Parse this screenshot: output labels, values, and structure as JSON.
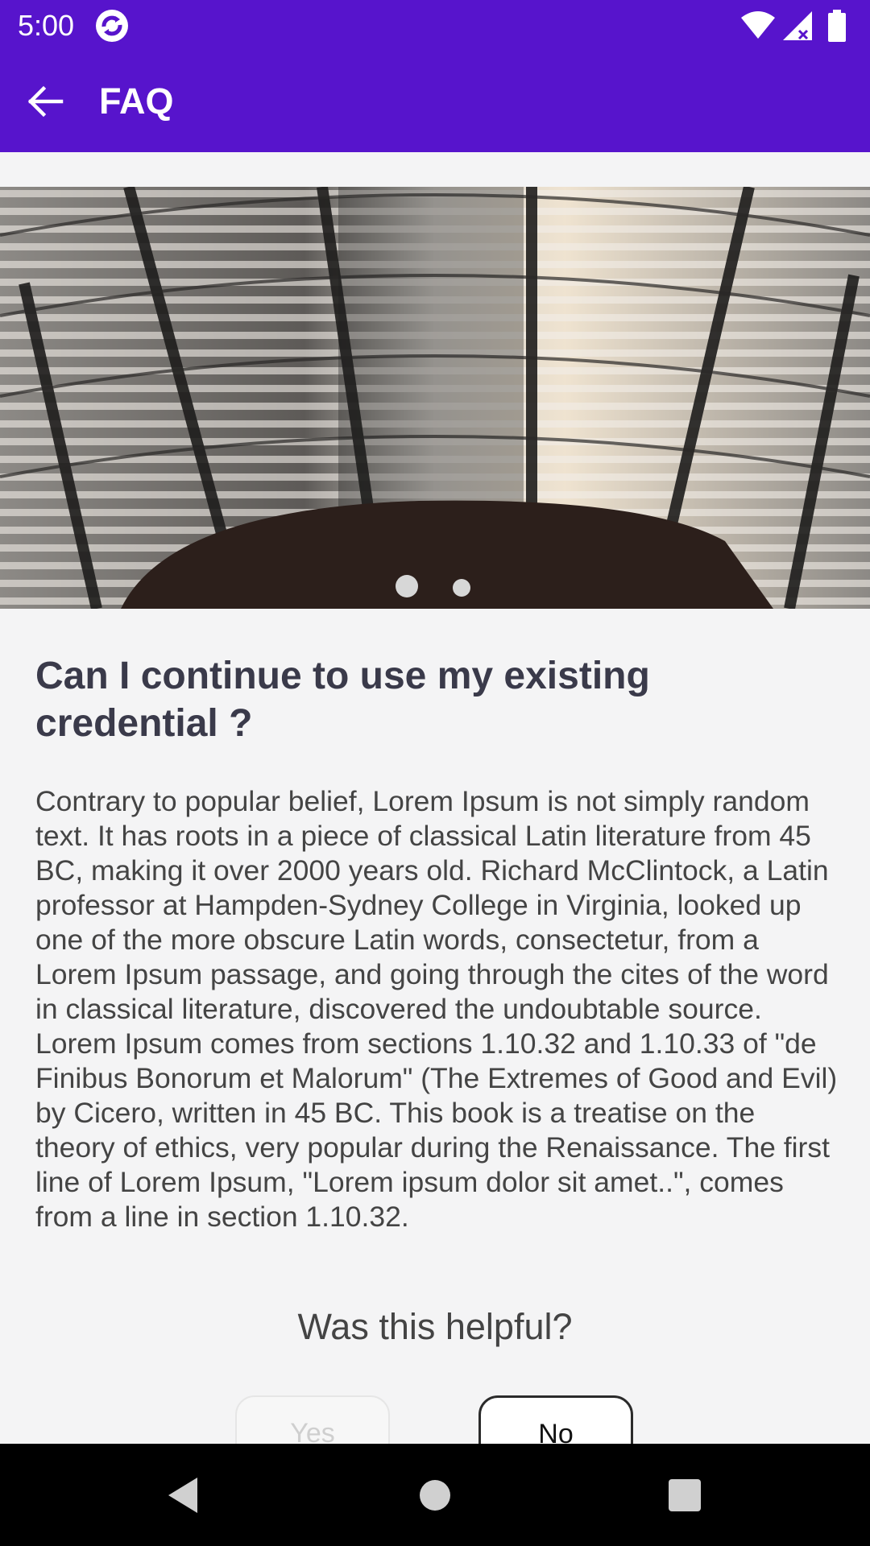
{
  "status_bar": {
    "time": "5:00",
    "icons": [
      "sync-app-icon",
      "wifi-icon",
      "cellular-signal-icon",
      "battery-icon"
    ]
  },
  "app_bar": {
    "title": "FAQ",
    "back_icon": "arrow-left-icon",
    "color": "#5714cc"
  },
  "carousel": {
    "image": "arena-roof-photo",
    "page_count": 2,
    "active_page": 1
  },
  "faq": {
    "question": "Can I continue to use my existing credential ?",
    "answer": "Contrary to popular belief, Lorem Ipsum is not simply random text. It has roots in a piece of classical Latin literature from 45 BC, making it over 2000 years old. Richard McClintock, a Latin professor at Hampden-Sydney College in Virginia, looked up one of the more obscure Latin words, consectetur, from a Lorem Ipsum passage, and going through the cites of the word in classical literature, discovered the undoubtable source. Lorem Ipsum comes from sections 1.10.32 and 1.10.33 of \"de Finibus Bonorum et Malorum\" (The Extremes of Good and Evil) by Cicero, written in 45 BC. This book is a treatise on the theory of ethics, very popular during the Renaissance. The first line of Lorem Ipsum, \"Lorem ipsum dolor sit amet..\", comes from a line in section 1.10.32."
  },
  "feedback": {
    "prompt": "Was this helpful?",
    "yes_label": "Yes",
    "no_label": "No",
    "yes_state": "disabled"
  },
  "nav_bar": {
    "icons": [
      "back-triangle-icon",
      "home-circle-icon",
      "recents-square-icon"
    ]
  }
}
